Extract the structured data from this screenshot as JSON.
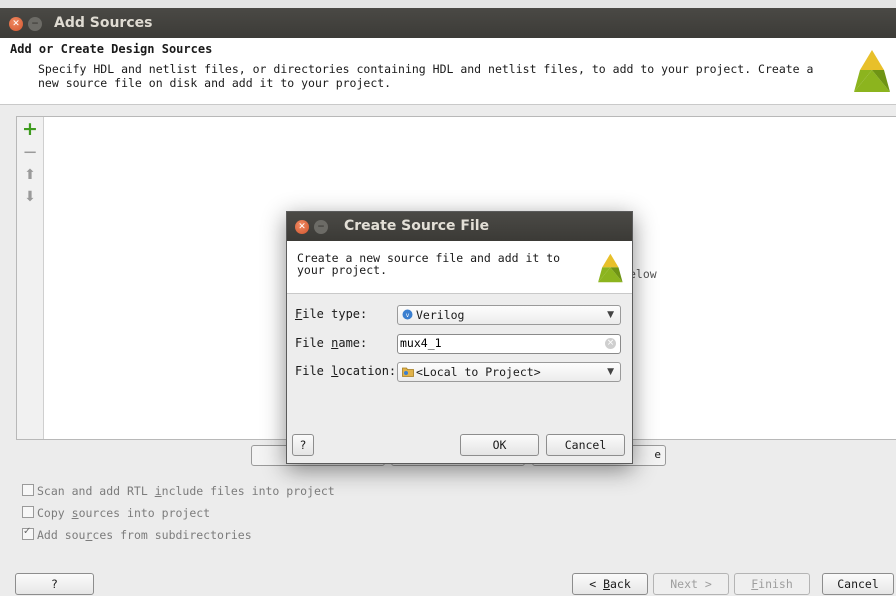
{
  "window": {
    "title": "Add Sources"
  },
  "header": {
    "title": "Add or Create Design Sources",
    "description": "Specify HDL and netlist files, or directories containing HDL and netlist files, to add to your project. Create a new source file on disk and add it to your project."
  },
  "panel": {
    "hint_fragment": "elow"
  },
  "options": {
    "scan_rtl": {
      "pre": "Scan and add RTL ",
      "u": "i",
      "post": "nclude files into project",
      "checked": false
    },
    "copy_sources": {
      "pre": "Copy ",
      "u": "s",
      "post": "ources into project",
      "checked": false
    },
    "add_subdirs": {
      "pre": "Add sou",
      "u": "r",
      "post": "ces from subdirectories",
      "checked": true
    }
  },
  "footer": {
    "help": "?",
    "back_u": "B",
    "back_rest": "ack",
    "next": "Next >",
    "finish_u": "F",
    "finish_rest": "inish",
    "cancel": "Cancel"
  },
  "dialog": {
    "title": "Create Source File",
    "description": "Create a new source file and add it to your project.",
    "file_type": {
      "label_u": "F",
      "label_rest": "ile type:",
      "value": "Verilog"
    },
    "file_name": {
      "label_pre": "File ",
      "label_u": "n",
      "label_rest": "ame:",
      "value": "mux4_1"
    },
    "file_location": {
      "label_pre": "File ",
      "label_u": "l",
      "label_rest": "ocation:",
      "value": "<Local to Project>"
    },
    "help": "?",
    "ok": "OK",
    "cancel": "Cancel"
  },
  "colors": {
    "titlebar": "#3c3b37",
    "close_button": "#e0613a",
    "add_icon": "#3e9b1e",
    "logo_green": "#8cb41e",
    "logo_yellow": "#e8c02a"
  }
}
